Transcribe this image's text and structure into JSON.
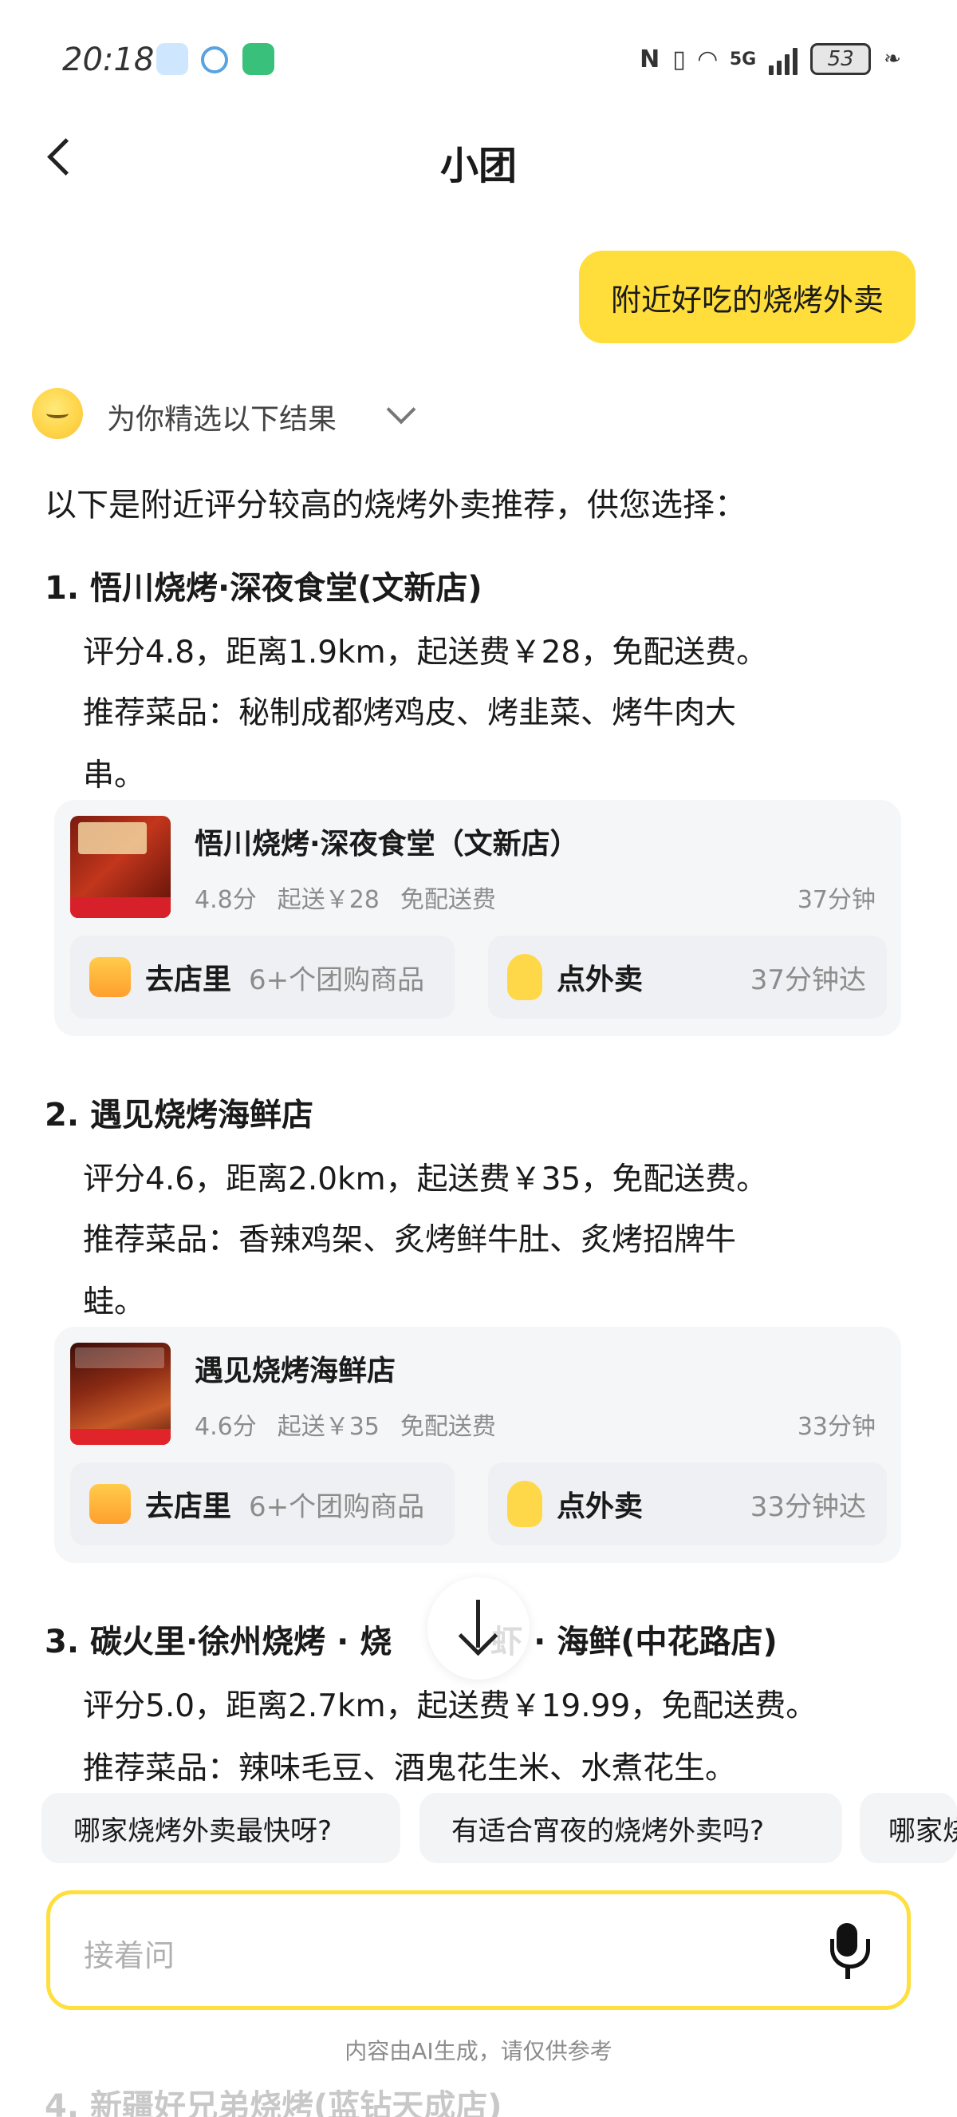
{
  "status_bar": {
    "time": "20:18",
    "signal_label": "5G",
    "battery": "53"
  },
  "header": {
    "title": "小团"
  },
  "user_message": "附近好吃的烧烤外卖",
  "ai": {
    "collapsed_title": "为你精选以下结果",
    "intro": "以下是附近评分较高的烧烤外卖推荐，供您选择："
  },
  "items": [
    {
      "heading": "1. 悟川烧烤·深夜食堂(文新店)",
      "line1": "评分4.8，距离1.9km，起送费￥28，免配送费。",
      "line2": "推荐菜品：秘制成都烤鸡皮、烤韭菜、烤牛肉大",
      "line3": "串。",
      "card": {
        "name": "悟川烧烤·深夜食堂（文新店）",
        "rating": "4.8分",
        "min_order": "起送￥28",
        "delivery": "免配送费",
        "eta": "37分钟",
        "btn_store": "去店里",
        "btn_store_sub": "6+个团购商品",
        "btn_delivery": "点外卖",
        "btn_delivery_eta": "37分钟达"
      }
    },
    {
      "heading": "2. 遇见烧烤海鲜店",
      "line1": "评分4.6，距离2.0km，起送费￥35，免配送费。",
      "line2": "推荐菜品：香辣鸡架、炙烤鲜牛肚、炙烤招牌牛",
      "line3": "蛙。",
      "card": {
        "name": "遇见烧烤海鲜店",
        "rating": "4.6分",
        "min_order": "起送￥35",
        "delivery": "免配送费",
        "eta": "33分钟",
        "btn_store": "去店里",
        "btn_store_sub": "6+个团购商品",
        "btn_delivery": "点外卖",
        "btn_delivery_eta": "33分钟达"
      }
    },
    {
      "heading": "3. 碳火里·徐州烧烤 · 烧",
      "heading_tail": "虾 · 海鲜(中花路店)",
      "line1": "评分5.0，距离2.7km，起送费￥19.99，免配送费。",
      "line2": "推荐菜品：辣味毛豆、酒鬼花生米、水煮花生。"
    }
  ],
  "suggestions": [
    "哪家烧烤外卖最快呀?",
    "有适合宵夜的烧烤外卖吗?",
    "哪家烧"
  ],
  "input": {
    "placeholder": "接着问"
  },
  "disclaimer": "内容由AI生成，请仅供参考",
  "faded_next": "4. 新疆好兄弟烧烤(蓝钻天成店)",
  "colors": {
    "accent": "#ffde3b",
    "card_bg": "#f5f6f8",
    "muted_text": "#8c8c8c"
  }
}
